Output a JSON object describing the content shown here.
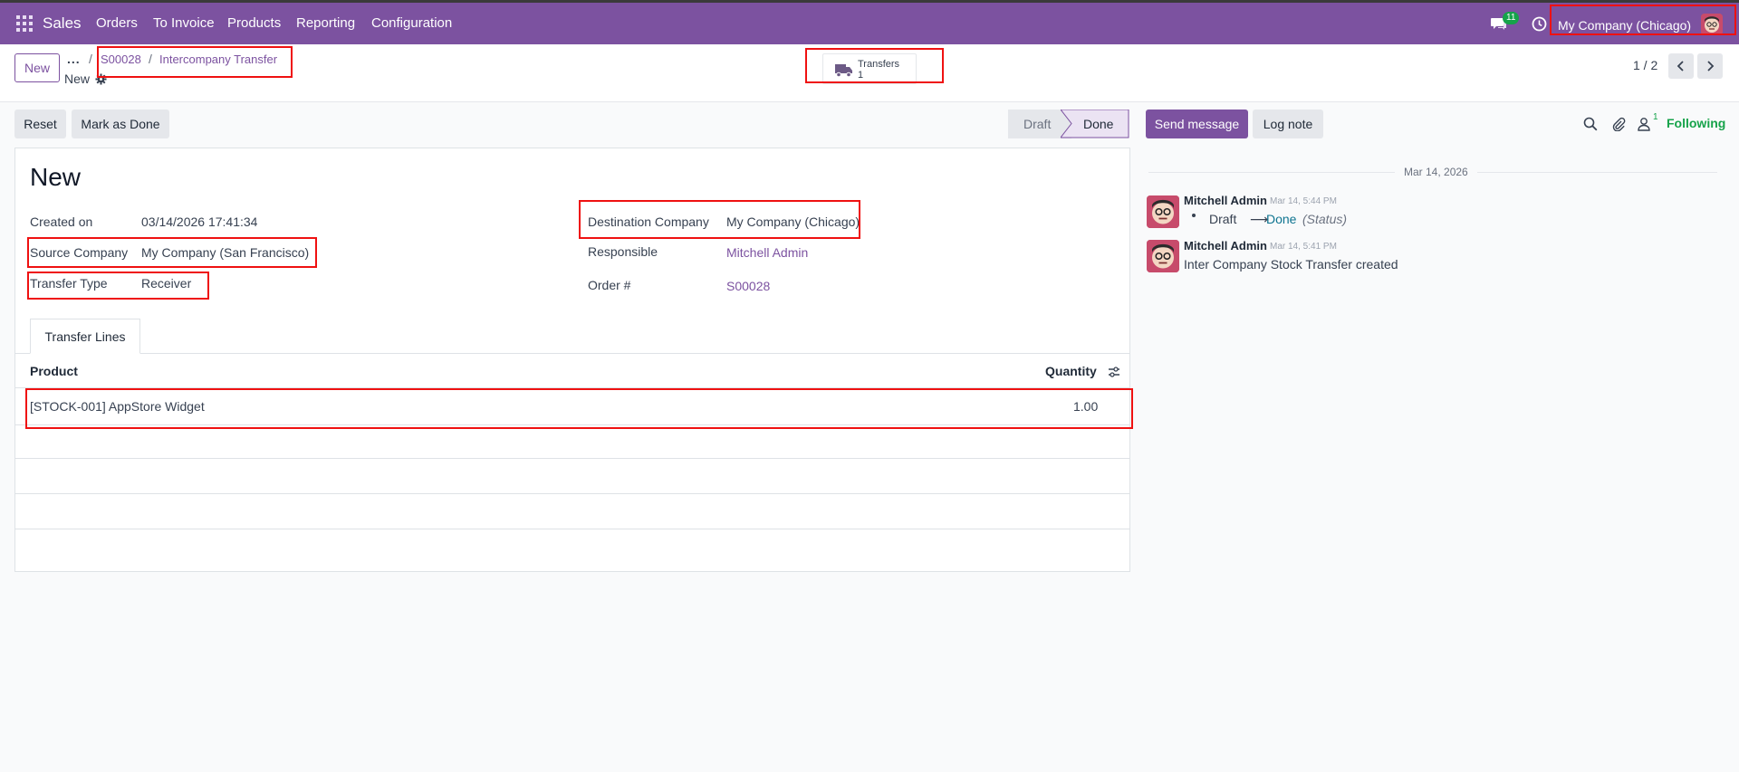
{
  "navbar": {
    "app_name": "Sales",
    "menu": [
      "Orders",
      "To Invoice",
      "Products",
      "Reporting",
      "Configuration"
    ],
    "message_badge": "11",
    "company": "My Company (Chicago)"
  },
  "control_panel": {
    "new_button": "New",
    "breadcrumb_dots": "...",
    "breadcrumb": [
      "S00028",
      "Intercompany Transfer"
    ],
    "record_name": "New",
    "smart_button": {
      "label": "Transfers",
      "count": "1"
    },
    "pager": "1 / 2"
  },
  "actions": {
    "reset": "Reset",
    "mark_done": "Mark as Done",
    "status": [
      "Draft",
      "Done"
    ],
    "active_status": "Done"
  },
  "form": {
    "title": "New",
    "fields": {
      "created_on": {
        "label": "Created on",
        "value": "03/14/2026 17:41:34"
      },
      "source_company": {
        "label": "Source Company",
        "value": "My Company (San Francisco)"
      },
      "transfer_type": {
        "label": "Transfer Type",
        "value": "Receiver"
      },
      "destination_company": {
        "label": "Destination Company",
        "value": "My Company (Chicago)"
      },
      "responsible": {
        "label": "Responsible",
        "value": "Mitchell Admin"
      },
      "order": {
        "label": "Order #",
        "value": "S00028"
      }
    },
    "tab": "Transfer Lines",
    "columns": {
      "product": "Product",
      "quantity": "Quantity"
    },
    "lines": [
      {
        "product": "[STOCK-001] AppStore Widget",
        "quantity": "1.00"
      }
    ]
  },
  "chatter": {
    "send_message": "Send message",
    "log_note": "Log note",
    "follower_count": "1",
    "following": "Following",
    "date": "Mar 14, 2026",
    "messages": [
      {
        "author": "Mitchell Admin",
        "time": "Mar 14, 5:44 PM",
        "from": "Draft",
        "arrow": "⟶",
        "to": "Done",
        "field": "(Status)"
      },
      {
        "author": "Mitchell Admin",
        "time": "Mar 14, 5:41 PM",
        "body": "Inter Company Stock Transfer created"
      }
    ]
  },
  "colors": {
    "brand": "#7c52a0",
    "highlight": "#ef1111",
    "following": "#16a34a",
    "status_link": "#0e7490"
  }
}
